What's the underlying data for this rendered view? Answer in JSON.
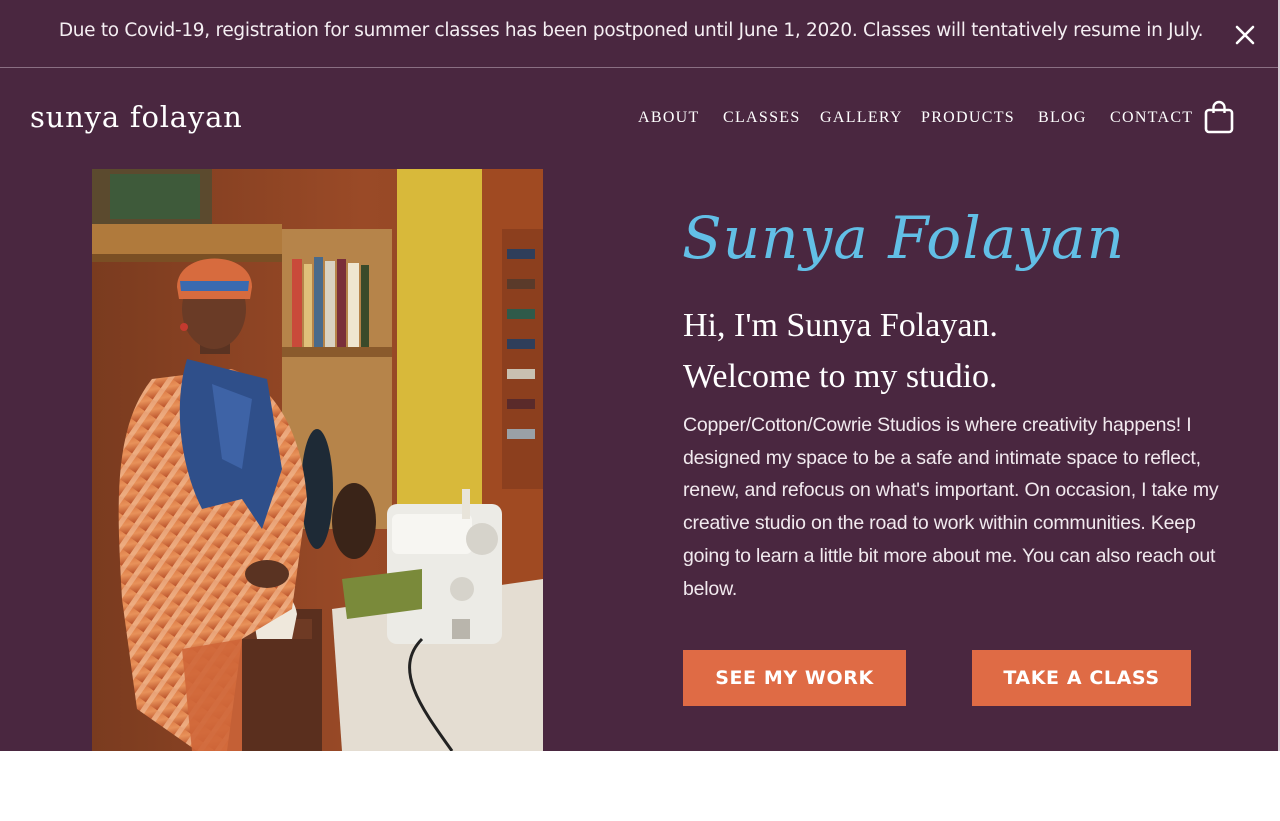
{
  "announcement": {
    "text": "Due to Covid-19, registration for summer classes has been postponed until June 1, 2020. Classes will tentatively resume in July.",
    "close_icon": "close-icon"
  },
  "header": {
    "logo": "sunya folayan",
    "nav": [
      "ABOUT",
      "CLASSES",
      "GALLERY",
      "PRODUCTS",
      "BLOG",
      "CONTACT"
    ],
    "cart_icon": "shopping-bag-icon"
  },
  "hero": {
    "script_name": "Sunya Folayan",
    "headline_line1": "Hi, I'm Sunya Folayan.",
    "headline_line2": "Welcome to my studio.",
    "intro": "Copper/Cotton/Cowrie Studios is where creativity happens! I designed my space to be a safe and intimate space to reflect, renew, and refocus on what's important. On occasion, I take my creative studio on the road to work within communities. Keep going to learn a little bit more about me. You can also reach out below.",
    "button_work": "SEE MY WORK",
    "button_class": "TAKE A CLASS"
  },
  "colors": {
    "background": "#4a2740",
    "script_accent": "#62bfe6",
    "button": "#df6b45"
  }
}
